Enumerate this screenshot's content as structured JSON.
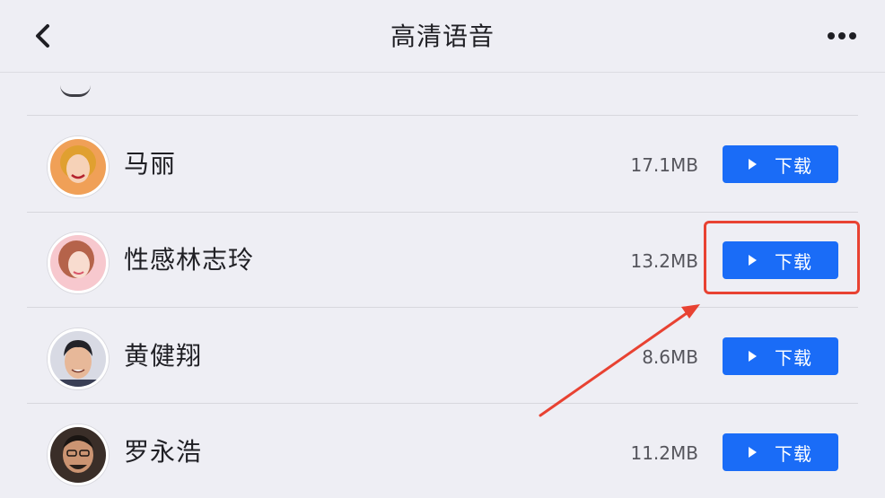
{
  "nav": {
    "title": "高清语音",
    "back_icon": "chevron-left-icon",
    "more_icon": "more-horizontal-icon"
  },
  "list": [
    {
      "name": "马丽",
      "size": "17.1MB",
      "button_label": "下载",
      "avatar_bg": "#F0A057",
      "avatar_hair": "#E0A030",
      "avatar_skin": "#F6D2B8"
    },
    {
      "name": "性感林志玲",
      "size": "13.2MB",
      "button_label": "下载",
      "avatar_bg": "#F7C8CE",
      "avatar_hair": "#B5634A",
      "avatar_skin": "#F8DCCF"
    },
    {
      "name": "黄健翔",
      "size": "8.6MB",
      "button_label": "下载",
      "avatar_bg": "#D8DAE4",
      "avatar_hair": "#222228",
      "avatar_skin": "#E7B899"
    },
    {
      "name": "罗永浩",
      "size": "11.2MB",
      "button_label": "下载",
      "avatar_bg": "#3A2E28",
      "avatar_hair": "#1A1512",
      "avatar_skin": "#CB9472"
    }
  ],
  "colors": {
    "accent": "#1A6CF7",
    "annotation": "#E84232",
    "background": "#EEEEF4"
  },
  "annotation": {
    "target": "下载",
    "shape": "rectangle-with-arrow"
  }
}
